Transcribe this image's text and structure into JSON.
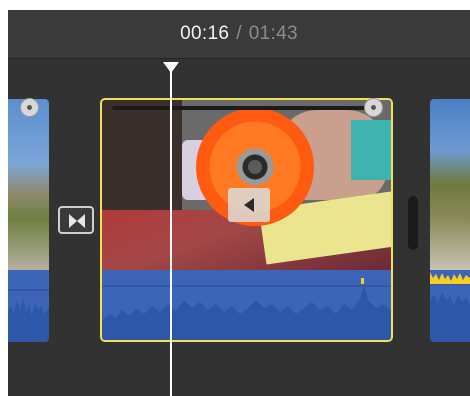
{
  "timecode": {
    "current": "00:16",
    "separator": "/",
    "total": "01:43"
  },
  "colors": {
    "background": "#323232",
    "selection": "#f1e15a",
    "audio_waveform": "#3c65b8",
    "audio_peak": "#f5d020",
    "playhead": "#ffffff"
  },
  "timeline": {
    "clips": [
      {
        "name": "clip-left",
        "selected": false
      },
      {
        "name": "clip-selected",
        "selected": true
      },
      {
        "name": "clip-right",
        "selected": false
      }
    ],
    "icons": [
      "transition-icon",
      "play-icon",
      "playhead-marker-icon",
      "trim-handle-icon"
    ]
  }
}
